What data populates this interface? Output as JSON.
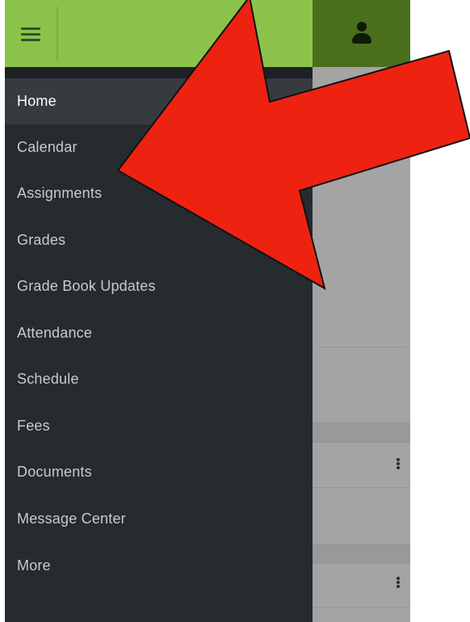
{
  "app_bar": {
    "menu_icon": "hamburger-icon",
    "profile_icon": "person-icon",
    "color": "#8bc34a",
    "profile_color": "#4a701e"
  },
  "drawer": {
    "background": "#262b2f",
    "active_index": 0,
    "items": [
      {
        "label": "Home"
      },
      {
        "label": "Calendar"
      },
      {
        "label": "Assignments"
      },
      {
        "label": "Grades"
      },
      {
        "label": "Grade Book Updates"
      },
      {
        "label": "Attendance"
      },
      {
        "label": "Schedule"
      },
      {
        "label": "Fees"
      },
      {
        "label": "Documents"
      },
      {
        "label": "Message Center"
      },
      {
        "label": "More"
      }
    ]
  },
  "background_content": {
    "overflow_icon": "more-vertical-icon"
  },
  "annotation": {
    "shape": "arrow",
    "color": "#ee2211",
    "points_to": "Assignments"
  }
}
